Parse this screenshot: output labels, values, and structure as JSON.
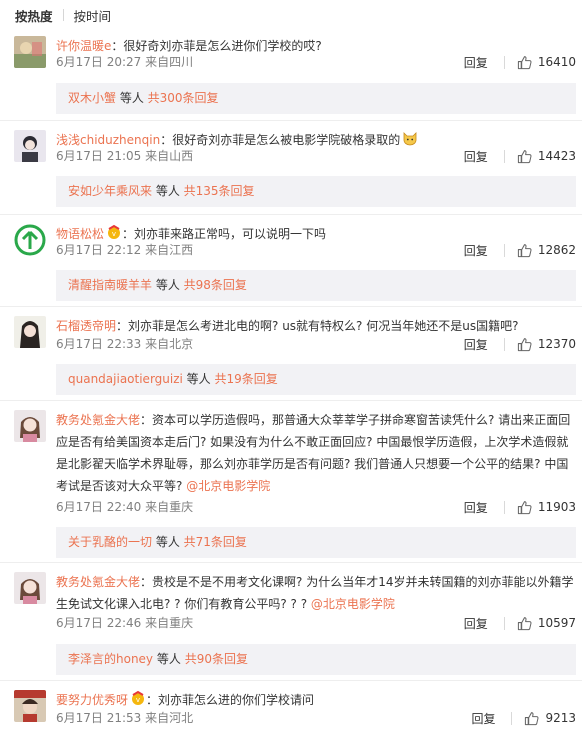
{
  "sort": {
    "active": "按热度",
    "other": "按时间"
  },
  "comments": [
    {
      "user": "许你温暖e",
      "text": "：很好奇刘亦菲是怎么进你们学校的哎?",
      "date": "6月17日 20:27",
      "location": "来自四川",
      "reply_label": "回复",
      "likes": "16410",
      "reply_preview": {
        "name": "双木小蟹",
        "mid": " 等人 ",
        "count": "共300条回复"
      }
    },
    {
      "user": "浅浅chiduzhenqin",
      "text": "：很好奇刘亦菲是怎么被电影学院破格录取的",
      "date": "6月17日 21:05",
      "location": "来自山西",
      "reply_label": "回复",
      "likes": "14423",
      "reply_preview": {
        "name": "安如少年乘风来",
        "mid": " 等人 ",
        "count": "共135条回复"
      }
    },
    {
      "user": "物语松松",
      "text": "：刘亦菲来路正常吗，可以说明一下吗",
      "date": "6月17日 22:12",
      "location": "来自江西",
      "reply_label": "回复",
      "likes": "12862",
      "reply_preview": {
        "name": "清醒指南暖羊羊",
        "mid": " 等人 ",
        "count": "共98条回复"
      }
    },
    {
      "user": "石榴透帝明",
      "text": "：刘亦菲是怎么考进北电的啊? us就有特权么? 何况当年她还不是us国籍吧?",
      "date": "6月17日 22:33",
      "location": "来自北京",
      "reply_label": "回复",
      "likes": "12370",
      "reply_preview": {
        "name": "quandajiaotierguizi",
        "mid": " 等人 ",
        "count": "共19条回复"
      }
    },
    {
      "user": "教务处氪金大佬",
      "text": "：资本可以学历造假吗，那普通大众莘莘学子拼命寒窗苦读凭什么? 请出来正面回应是否有给美国资本走后门? 如果没有为什么不敢正面回应? 中国最恨学历造假，上次学术造假就是北影翟天临学术界耻辱，那么刘亦菲学历是否有问题? 我们普通人只想要一个公平的结果? 中国考试是否该对大众平等? ",
      "mention": "@北京电影学院",
      "date": "6月17日 22:40",
      "location": "来自重庆",
      "reply_label": "回复",
      "likes": "11903",
      "reply_preview": {
        "name": "关于乳酪的一切",
        "mid": " 等人 ",
        "count": "共71条回复"
      }
    },
    {
      "user": "教务处氪金大佬",
      "text": "：贵校是不是不用考文化课啊? 为什么当年才14岁并未转国籍的刘亦菲能以外籍学生免试文化课入北电? ? 你们有教育公平吗? ? ? ",
      "mention": "@北京电影学院",
      "date": "6月17日 22:46",
      "location": "来自重庆",
      "reply_label": "回复",
      "likes": "10597",
      "reply_preview": {
        "name": "李泽言的honey",
        "mid": " 等人 ",
        "count": "共90条回复"
      }
    },
    {
      "user": "要努力优秀呀",
      "text": "：刘亦菲怎么进的你们学校请问",
      "date": "6月17日 21:53",
      "location": "来自河北",
      "reply_label": "回复",
      "likes": "9213"
    }
  ]
}
